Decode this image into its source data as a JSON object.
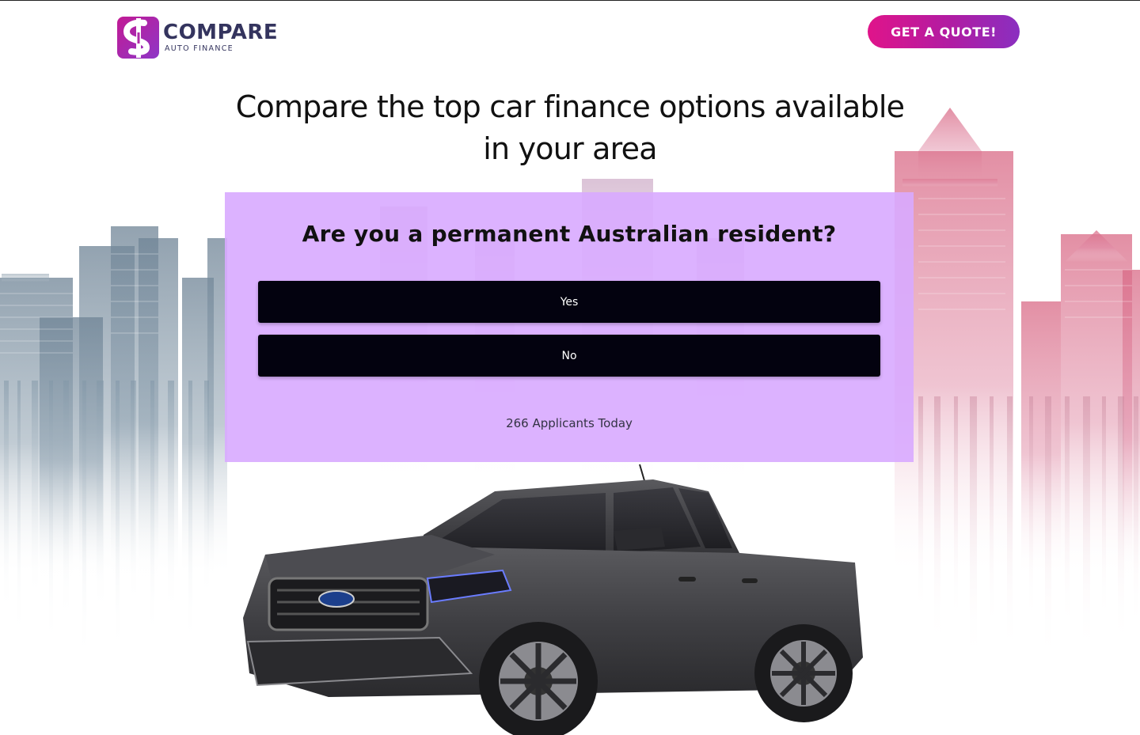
{
  "header": {
    "logo_title": "COMPARE",
    "logo_subtitle": "AUTO FINANCE",
    "quote_button_label": "GET A QUOTE!"
  },
  "hero": {
    "headline": "Compare the top car finance options available in your area"
  },
  "question_panel": {
    "question": "Are you a permanent Australian resident?",
    "options": [
      {
        "label": "Yes"
      },
      {
        "label": "No"
      }
    ],
    "applicants_text": "266 Applicants Today"
  },
  "icons": {
    "logo": "dollar-sign-logo-icon",
    "vehicle": "pickup-truck-image",
    "background": "city-skyline-image"
  },
  "colors": {
    "brand_pink": "#e0148a",
    "brand_purple": "#8a2fc0",
    "logo_text": "#34345e",
    "panel_bg": "#d8aaff",
    "option_button_bg": "#03020f"
  }
}
